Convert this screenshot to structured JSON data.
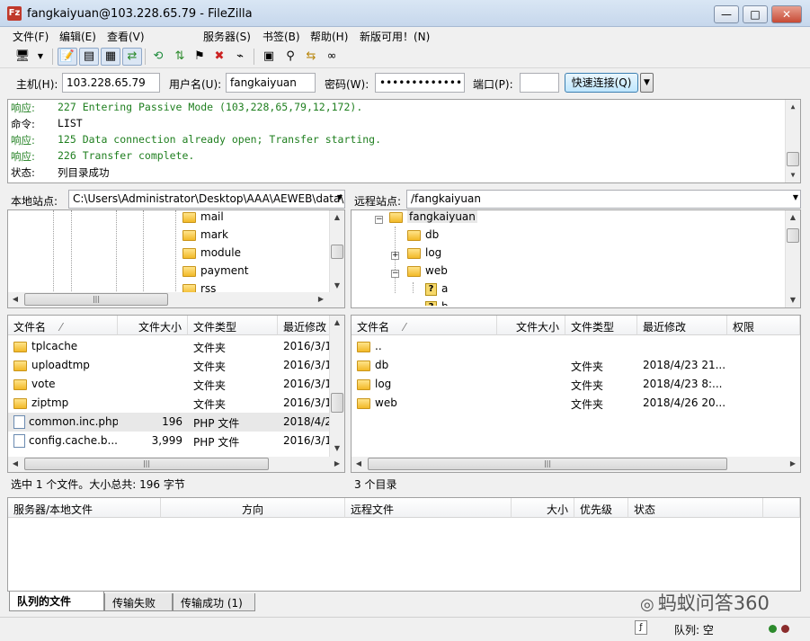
{
  "window": {
    "title": "fangkaiyuan@103.228.65.79 - FileZilla",
    "app_icon": "Fz",
    "minimize": "—",
    "maximize": "□",
    "close": "✕"
  },
  "menu": [
    "文件(F)",
    "编辑(E)",
    "查看(V)",
    "服务器(S)",
    "书签(B)",
    "帮助(H)",
    "新版可用！(N)"
  ],
  "toolbar": {
    "icons": [
      "site-manager-icon",
      "dropdown-icon",
      "message-log-icon",
      "tree-icon",
      "remote-tree-icon",
      "queue-icon",
      "refresh-icon",
      "process-queue-icon",
      "flag-icon",
      "cancel-icon",
      "disconnect-icon",
      "compare-icon",
      "filter-icon",
      "sync-browse-icon",
      "search-icon"
    ]
  },
  "quickconnect": {
    "host_label": "主机(H):",
    "host_value": "103.228.65.79",
    "user_label": "用户名(U):",
    "user_value": "fangkaiyuan",
    "pass_label": "密码(W):",
    "pass_value": "•••••••••••••",
    "port_label": "端口(P):",
    "port_value": "",
    "connect_label": "快速连接(Q)",
    "dropdown": "▼"
  },
  "log": [
    {
      "label": "响应:",
      "text": "227 Entering Passive Mode (103,228,65,79,12,172).",
      "color": "#1f7f1f"
    },
    {
      "label": "命令:",
      "text": "LIST",
      "color": "#000000"
    },
    {
      "label": "响应:",
      "text": "125 Data connection already open; Transfer starting.",
      "color": "#1f7f1f"
    },
    {
      "label": "响应:",
      "text": "226 Transfer complete.",
      "color": "#1f7f1f"
    },
    {
      "label": "状态:",
      "text": "列目录成功",
      "color": "#000000"
    }
  ],
  "local": {
    "site_label": "本地站点:",
    "site_path": "C:\\Users\\Administrator\\Desktop\\AAA\\AEWEB\\data\\",
    "tree": [
      "mail",
      "mark",
      "module",
      "payment",
      "rss"
    ],
    "columns": [
      "文件名",
      "文件大小",
      "文件类型",
      "最近修改"
    ],
    "sort_indicator": "⁄",
    "files": [
      {
        "name": "tplcache",
        "size": "",
        "type": "文件夹",
        "modified": "2016/3/1",
        "icon": "folder"
      },
      {
        "name": "uploadtmp",
        "size": "",
        "type": "文件夹",
        "modified": "2016/3/1",
        "icon": "folder"
      },
      {
        "name": "vote",
        "size": "",
        "type": "文件夹",
        "modified": "2016/3/1",
        "icon": "folder"
      },
      {
        "name": "ziptmp",
        "size": "",
        "type": "文件夹",
        "modified": "2016/3/1",
        "icon": "folder"
      },
      {
        "name": "common.inc.php",
        "size": "196",
        "type": "PHP 文件",
        "modified": "2018/4/2",
        "icon": "file"
      },
      {
        "name": "config.cache.b...",
        "size": "3,999",
        "type": "PHP 文件",
        "modified": "2016/3/1",
        "icon": "file"
      }
    ],
    "status": "选中 1 个文件。大小总共: 196 字节"
  },
  "remote": {
    "site_label": "远程站点:",
    "site_path": "/fangkaiyuan",
    "tree": [
      {
        "name": "fangkaiyuan",
        "expander": "−"
      },
      {
        "name": "db",
        "expander": ""
      },
      {
        "name": "log",
        "expander": "+"
      },
      {
        "name": "web",
        "expander": "−"
      },
      {
        "name": "a",
        "expander": ""
      },
      {
        "name": "b",
        "expander": ""
      }
    ],
    "columns": [
      "文件名",
      "文件大小",
      "文件类型",
      "最近修改",
      "权限"
    ],
    "sort_indicator": "⁄",
    "files": [
      {
        "name": "..",
        "type": "",
        "modified": ""
      },
      {
        "name": "db",
        "type": "文件夹",
        "modified": "2018/4/23 21..."
      },
      {
        "name": "log",
        "type": "文件夹",
        "modified": "2018/4/23 8:..."
      },
      {
        "name": "web",
        "type": "文件夹",
        "modified": "2018/4/26 20..."
      }
    ],
    "status": "3 个目录"
  },
  "queue": {
    "columns": [
      "服务器/本地文件",
      "方向",
      "远程文件",
      "大小",
      "优先级",
      "状态"
    ]
  },
  "tabs": [
    "队列的文件",
    "传输失败",
    "传输成功 (1)"
  ],
  "statusbar": {
    "queue_label": "队列: 空"
  },
  "watermark": "蚂蚁问答360",
  "colors": {
    "response": "#1f7f1f",
    "selection": "#e8e8e8"
  }
}
